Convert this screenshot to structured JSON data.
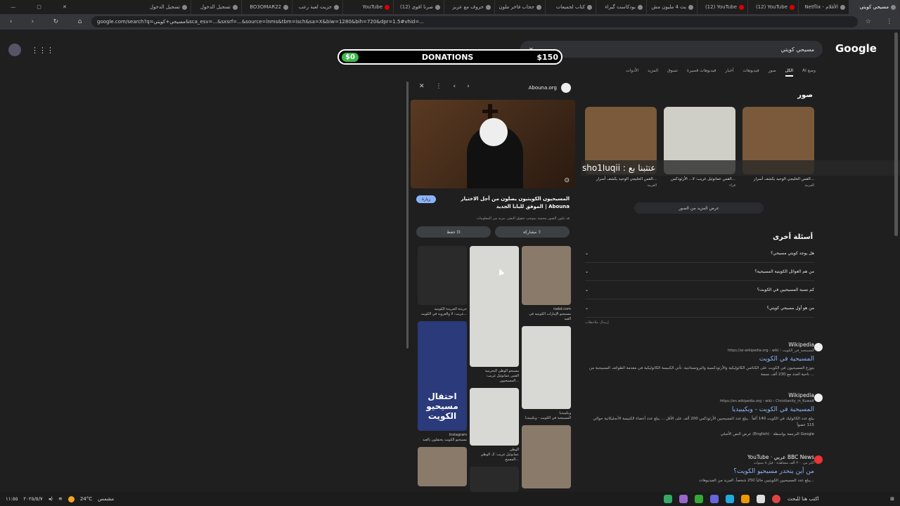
{
  "browser": {
    "tabs": [
      {
        "label": "مسيحي كويتي",
        "active": true
      },
      {
        "label": "Netflix - الأفلام"
      },
      {
        "label": "(12) YouTube"
      },
      {
        "label": "(12) YouTube"
      },
      {
        "label": "بث 4 مليون مش"
      },
      {
        "label": "بودكاست گيراء"
      },
      {
        "label": "كتاب لجميعات"
      },
      {
        "label": "حجاب فاخر ملون"
      },
      {
        "label": "حروف مع عزيز"
      },
      {
        "label": "(12) صرنا اقوى"
      },
      {
        "label": "YouTube"
      },
      {
        "label": "جزيت لعبة رعب"
      },
      {
        "label": "BO3OMAR22"
      },
      {
        "label": "تسجيل الدخول"
      },
      {
        "label": "تسجيل الدخول"
      }
    ],
    "url": "google.com/search?q=مسيحي+كويتي&sca_esv=...&sxsrf=...&source=lnms&tbm=isch&sa=X&biw=1280&bih=720&dpr=1.5#vhid=..."
  },
  "donations": {
    "left": "$0",
    "label": "DONATIONS",
    "right": "$150"
  },
  "google": {
    "logo": "Google",
    "query": "مسيحي كويتي",
    "tabs": [
      "وضع AI",
      "الكل",
      "صور",
      "فيديوهات",
      "أخبار",
      "فيديوهات قصيرة",
      "تسوق",
      "المزيد",
      "الأدوات"
    ]
  },
  "preview": {
    "source": "Abouna.org",
    "title": "المسيحيون الكويتيون يصلون من أجل الاختيار الموفق للبابا الجديد | Abouna",
    "visit": "زيارة",
    "note": "قد تكون الصور محمية بموجب حقوق النشر. مزيد من المعلومات",
    "share": "مشاركة",
    "save": "حفظ",
    "related": [
      {
        "source": "nabd.com",
        "caption": "مسيحيو الإمارات الكويتية في العيد"
      },
      {
        "source": "ويكيبيديا",
        "caption": "المسيحية في الكويت - ويكيبيديا"
      },
      {
        "source": "مسيحو الوطن البحرينية",
        "caption": "القس عمانوئيل غريب: المسيحيون..."
      },
      {
        "source": "الوطن",
        "caption": "عمانوئيل غريب: 2، الوطن المسيح..."
      },
      {
        "source": "جريدة الجريدة الكويتية",
        "caption": "غريب: لا والعروبة في الكويت..."
      },
      {
        "source": "Instagram",
        "caption": "مسيحيو الكويت يحتفلون بالعيد"
      }
    ],
    "banner": "احتفال مسيحيو الكويت"
  },
  "images_section": {
    "title": "صور",
    "cards": [
      {
        "title": "القس الخليجي الوحيد يكشف أسرار...",
        "source": "العربية"
      },
      {
        "title": "القس عمانوئيل غريب: لا... الأرثوذكس...",
        "source": "قراء"
      },
      {
        "title": "القس الخليجي الوحيد يكشف أسرار...",
        "source": "العربية"
      }
    ],
    "more": "عرض المزيد من الصور"
  },
  "overlay_text": "shoا1uqii : عتثبنا بع",
  "paa": {
    "title": "أسئلة أخرى",
    "questions": [
      "هل يوجد كويتي مسيحي؟",
      "من هم العوائل الكويتية المسيحية؟",
      "كم نسبة المسيحيين في الكويت؟",
      "من هو أول مسيحي كويتي؟"
    ],
    "feedback": "إرسال ملاحظات"
  },
  "results": [
    {
      "site": "Wikipedia",
      "cite": "https://ar.wikipedia.org › wiki › المسيحية_في_الكويت",
      "link": "المسيحية في الكويت",
      "snippet": "يتوزع المسيحيون في الكويت على الكنائس الكاثوليكية والأرثوذكسية والبروتستانتية. تأتي الكنيسة الكاثوليكية في مقدمة الطوائف المسيحية من ناحية العدد مع 230 ألف نسمة ..."
    },
    {
      "site": "Wikipedia",
      "cite": "https://en.wikipedia.org › wiki › Christianity_in_Kuwait",
      "link": "المسيحية في الكويت - ويكيبيديا",
      "snippet": "يبلغ عدد الكاثوليك في الكويت 140 ألفاً . يبلغ عدد المسيحيين الأرثوذكس 200 ألف على الأقل ... يبلغ عدد أعضاء الكنيسة الأنجليكانية حوالي 115 عضواً",
      "extra": "عرض النص الأصلي (English) · الترجمة بواسطة Google"
    },
    {
      "site": "YouTube · عربي BBC News",
      "cite": "أكثر من ٣٠٠ ألف مشاهدة · قبل ٨ سنوات",
      "link": "من أين ينحدر مسيحيو الكويت؟",
      "snippet": "يبلغ عدد المسيحيين الكويتيين حالياً 250 شخصاً. المزيد من الفيديوهات..."
    }
  ],
  "taskbar": {
    "weather": "24°C",
    "weather_label": "مشمس",
    "search": "اكتب هنا للبحث",
    "time": "١١:٥٥",
    "date": "٢٠٢٥/٥/٧"
  }
}
